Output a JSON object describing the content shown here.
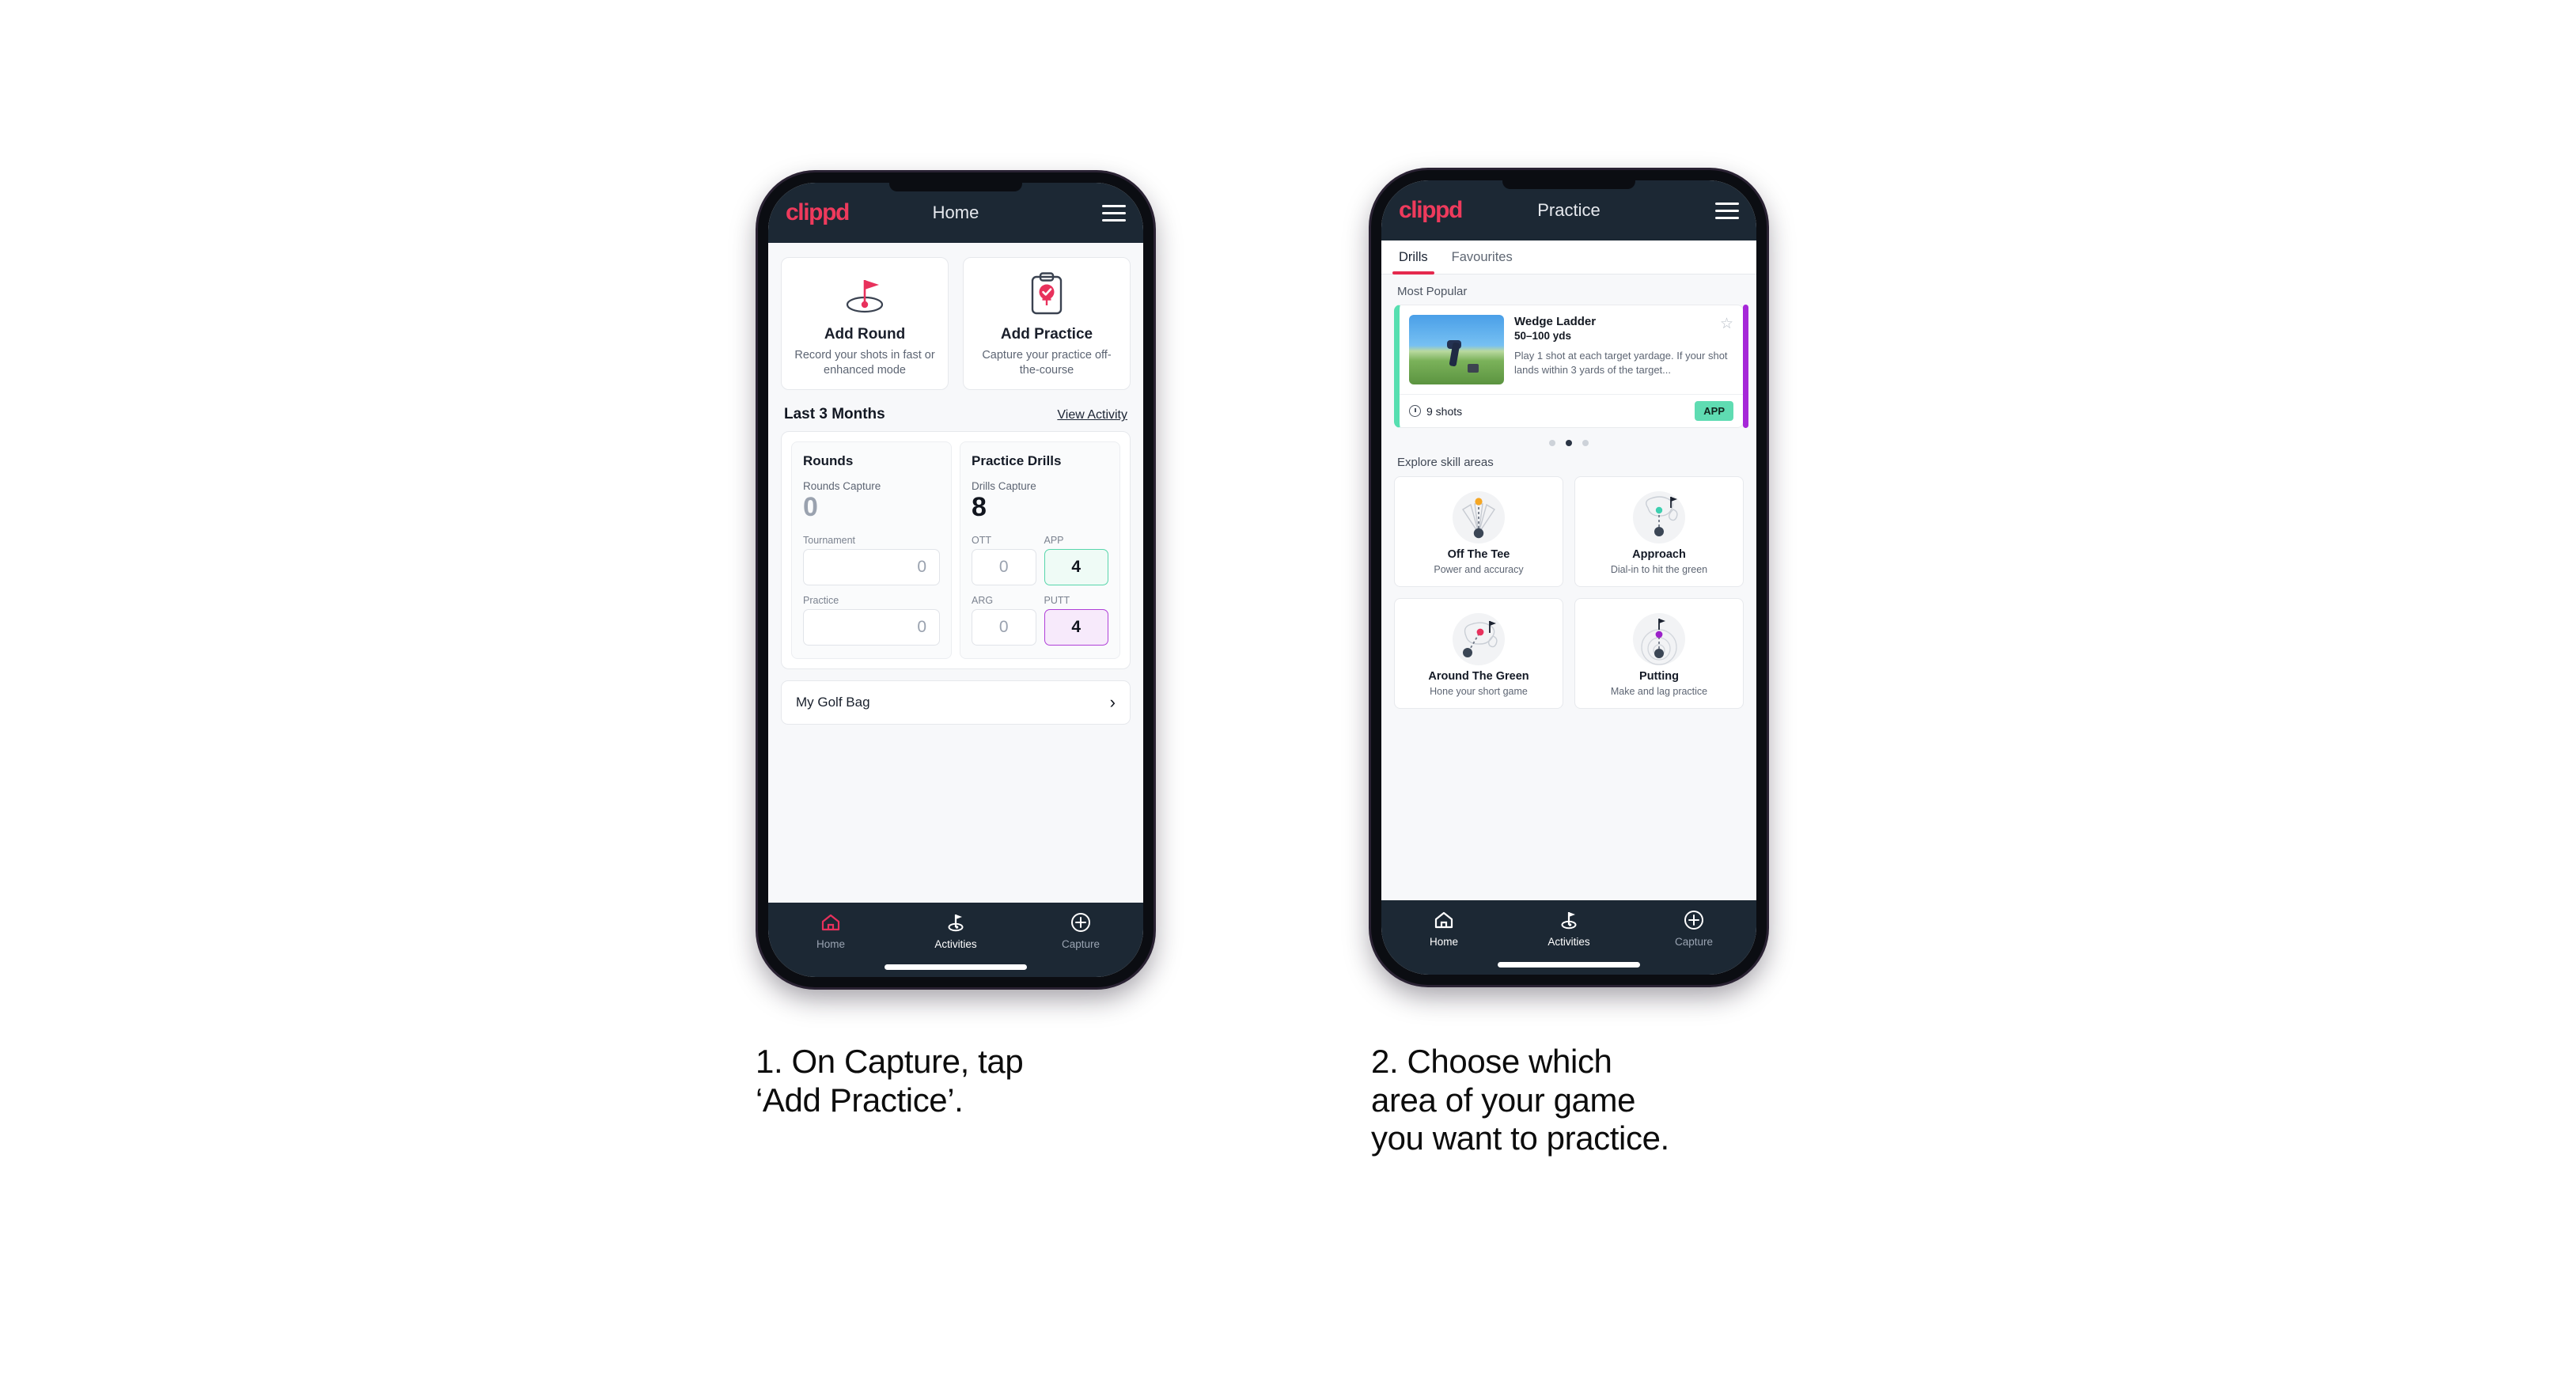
{
  "brand": "clippd",
  "phone1": {
    "header": {
      "title": "Home",
      "menu_icon": "hamburger-icon"
    },
    "actions": [
      {
        "icon": "golf-flag-hole-icon",
        "title": "Add Round",
        "subtitle": "Record your shots in fast or enhanced mode"
      },
      {
        "icon": "clipboard-check-icon",
        "title": "Add Practice",
        "subtitle": "Capture your practice off-the-course"
      }
    ],
    "section": {
      "title": "Last 3 Months",
      "link": "View Activity"
    },
    "rounds": {
      "title": "Rounds",
      "capture_label": "Rounds Capture",
      "capture_value": "0",
      "fields": [
        {
          "label": "Tournament",
          "value": "0",
          "style": "plain"
        },
        {
          "label": "Practice",
          "value": "0",
          "style": "plain"
        }
      ]
    },
    "drills": {
      "title": "Practice Drills",
      "capture_label": "Drills Capture",
      "capture_value": "8",
      "fields": [
        {
          "label": "OTT",
          "value": "0",
          "style": "plain"
        },
        {
          "label": "APP",
          "value": "4",
          "style": "app"
        },
        {
          "label": "ARG",
          "value": "0",
          "style": "plain"
        },
        {
          "label": "PUTT",
          "value": "4",
          "style": "putt"
        }
      ]
    },
    "golf_bag": {
      "label": "My Golf Bag",
      "chevron": "chevron-right-icon"
    },
    "nav": [
      {
        "label": "Home",
        "icon": "home-icon",
        "state": "active-pink"
      },
      {
        "label": "Activities",
        "icon": "golf-flag-icon",
        "state": "active"
      },
      {
        "label": "Capture",
        "icon": "plus-circle-icon",
        "state": "dim"
      }
    ]
  },
  "phone2": {
    "header": {
      "title": "Practice",
      "menu_icon": "hamburger-icon"
    },
    "tabs": [
      {
        "label": "Drills",
        "active": true
      },
      {
        "label": "Favourites",
        "active": false
      }
    ],
    "most_popular_label": "Most Popular",
    "drill": {
      "name": "Wedge Ladder",
      "yardage": "50–100 yds",
      "description": "Play 1 shot at each target yardage. If your shot lands within 3 yards of the target...",
      "shots": "9 shots",
      "badge": "APP",
      "star_icon": "star-outline-icon",
      "clock_icon": "clock-icon",
      "accent_left": "#56dfb0",
      "accent_right": "#a628d8"
    },
    "carousel_dots": {
      "count": 3,
      "active_index": 1
    },
    "skills_label": "Explore skill areas",
    "skills": [
      {
        "icon": "off-the-tee-icon",
        "title": "Off The Tee",
        "subtitle": "Power and accuracy",
        "dot_color": "#f5a623"
      },
      {
        "icon": "approach-icon",
        "title": "Approach",
        "subtitle": "Dial-in to hit the green",
        "dot_color": "#3ecfb0"
      },
      {
        "icon": "around-the-green-icon",
        "title": "Around The Green",
        "subtitle": "Hone your short game",
        "dot_color": "#e8315c"
      },
      {
        "icon": "putting-icon",
        "title": "Putting",
        "subtitle": "Make and lag practice",
        "dot_color": "#9b22c9"
      }
    ],
    "nav": [
      {
        "label": "Home",
        "icon": "home-icon",
        "state": "white"
      },
      {
        "label": "Activities",
        "icon": "golf-flag-icon",
        "state": "active"
      },
      {
        "label": "Capture",
        "icon": "plus-circle-icon",
        "state": "dim"
      }
    ]
  },
  "captions": {
    "step1": "1. On Capture, tap\n‘Add Practice’.",
    "step2": "2. Choose which\narea of your game\nyou want to practice."
  },
  "colors": {
    "brand_pink": "#ee3a5c",
    "header_navy": "#1c2834",
    "accent_green": "#56dfb0",
    "accent_purple": "#a628d8",
    "tab_underline": "#e4294d"
  }
}
